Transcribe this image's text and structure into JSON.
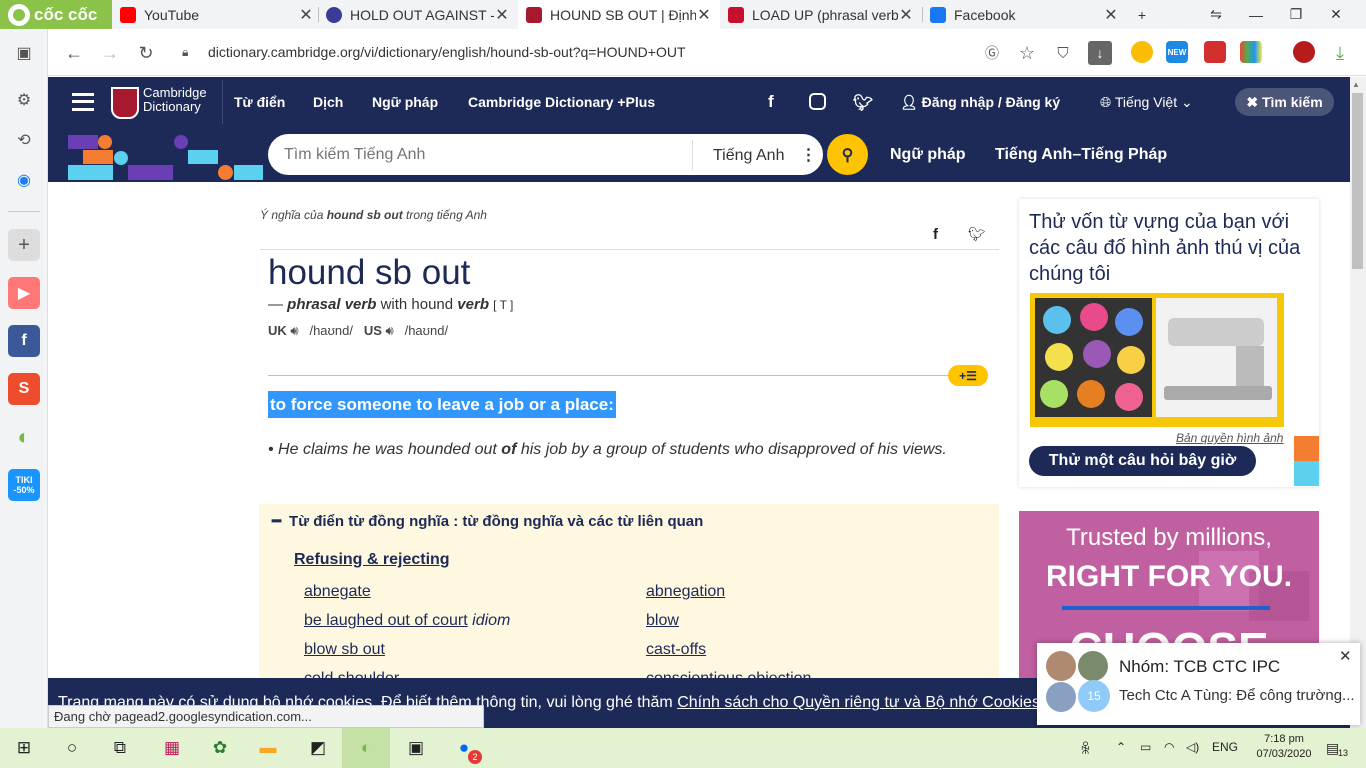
{
  "browser": {
    "brand": "cốc cốc",
    "tabs": [
      {
        "title": "YouTube",
        "icon": "youtube-icon",
        "color": "#ff0000"
      },
      {
        "title": "HOLD OUT AGAINST - Đ",
        "icon": "globe-icon",
        "color": "#3b3b9a"
      },
      {
        "title": "HOUND SB OUT | Định",
        "icon": "cambridge-icon",
        "color": "#a6192e"
      },
      {
        "title": "LOAD UP (phrasal verb)",
        "icon": "wordreference-icon",
        "color": "#c8102e"
      },
      {
        "title": "Facebook",
        "icon": "facebook-icon",
        "color": "#1877f2"
      }
    ],
    "new_tab": "+",
    "url": "dictionary.cambridge.org/vi/dictionary/english/hound-sb-out?q=HOUND+OUT",
    "new_badge": "NEW",
    "tiki_label": "TIKI -50%"
  },
  "site": {
    "logo_line1": "Cambridge",
    "logo_line2": "Dictionary",
    "nav": [
      "Từ điển",
      "Dịch",
      "Ngữ pháp",
      "Cambridge Dictionary +Plus"
    ],
    "login": "Đăng nhập / Đăng ký",
    "language": "Tiếng Việt",
    "search_button": "Tìm kiếm",
    "search_placeholder": "Tìm kiếm Tiếng Anh",
    "search_lang": "Tiếng Anh",
    "sub_nav": [
      "Ngữ pháp",
      "Tiếng Anh–Tiếng Pháp"
    ],
    "brand_blue": "#1d2a57",
    "accent_yellow": "#fec400"
  },
  "entry": {
    "breadcrumb_pre": "Ý nghĩa của ",
    "breadcrumb_word": "hound sb out",
    "breadcrumb_post": " trong tiếng Anh",
    "headword": "hound sb out",
    "dash": "—",
    "pos": "phrasal verb",
    "with_text": "with hound",
    "pos2": "verb",
    "grammar": "[ T ]",
    "uk_label": "UK",
    "uk_ipa": "/haʊnd/",
    "us_label": "US",
    "us_ipa": "/haʊnd/",
    "definition": "to force someone to leave a job or a place:",
    "example_pre": "He claims he was hounded out ",
    "example_bold": "of",
    "example_post": " his job by a group of students who disapproved of his views.",
    "thesaurus_heading": "Từ điển từ đồng nghĩa : từ đồng nghĩa và các từ liên quan",
    "thesaurus_category": "Refusing & rejecting",
    "thesaurus_col1": [
      "abnegate",
      "be laughed out of court",
      "blow sb out",
      "cold shoulder"
    ],
    "thesaurus_col1_note": "idiom",
    "thesaurus_col2": [
      "abnegation",
      "blow",
      "cast-offs",
      "conscientious objection"
    ]
  },
  "quiz": {
    "title": "Thử vốn từ vựng của bạn với các câu đố hình ảnh thú vị của chúng tôi",
    "credit": "Bản quyền hình ảnh",
    "button": "Thử một câu hỏi bây giờ"
  },
  "ad": {
    "line1": "Trusted by millions,",
    "line2": "RIGHT FOR YOU.",
    "line3": "CHOOSE"
  },
  "cookie": {
    "text": "Trang mạng này có sử dụng bộ nhớ cookies. Để biết thêm thông tin, vui lòng ghé thăm ",
    "link": "Chính sách cho Quyền riêng tư và Bộ nhớ Cookies"
  },
  "status_bar": "Đang chờ pagead2.googlesyndication.com...",
  "notification": {
    "title": "Nhóm: TCB CTC IPC",
    "message": "Tech Ctc A Tùng: Để công trường...",
    "count": "15"
  },
  "taskbar": {
    "language": "ENG",
    "time": "7:18 pm",
    "date": "07/03/2020",
    "notif_count": "13",
    "zalo_badge": "2"
  }
}
